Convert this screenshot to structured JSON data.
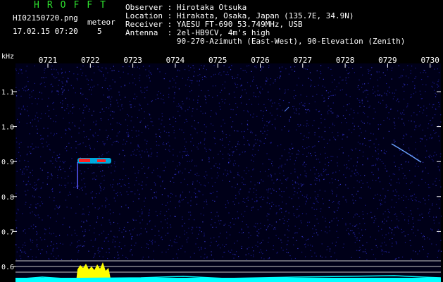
{
  "header": {
    "brand": "HROFFT",
    "filename": "HI02150720.png",
    "timestamp": "17.02.15 07:20",
    "meteor_label": "meteor",
    "meteor_count": "5"
  },
  "station_info": [
    {
      "key": "Observer",
      "value": "Hirotaka Otsuka"
    },
    {
      "key": "Location",
      "value": "Hirakata, Osaka, Japan (135.7E, 34.9N)"
    },
    {
      "key": "Receiver",
      "value": "YAESU FT-690 53.749MHz, USB"
    },
    {
      "key": "Antenna ",
      "value": "2el-HB9CV, 4m's high"
    },
    {
      "key": "",
      "value": "90-270-Azimuth (East-West), 90-Elevation (Zenith)"
    }
  ],
  "axis": {
    "y_unit": "kHz",
    "x_ticks": [
      "0721",
      "0722",
      "0723",
      "0724",
      "0725",
      "0726",
      "0727",
      "0728",
      "0729",
      "0730"
    ],
    "y_ticks": [
      "1.1",
      "1.0",
      "0.9",
      "0.8",
      "0.7",
      "0.6"
    ]
  },
  "colors": {
    "background": "#000000",
    "spectrogram_noise": "#1a1a8c",
    "echo_core": "#ff2020",
    "echo_edge": "#00c8ff",
    "grid": "#ffffff",
    "amplitude_fill": "#ffff00",
    "amplitude_base": "#00ffff",
    "brand": "#2ee02e"
  }
}
